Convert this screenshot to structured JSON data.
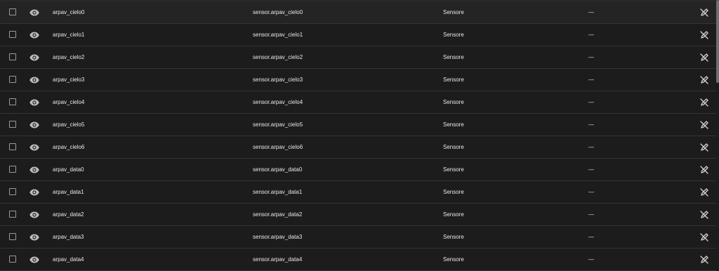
{
  "rows": [
    {
      "name": "arpav_cielo0",
      "entity_id": "sensor.arpav_cielo0",
      "integration": "Sensore",
      "area": "—"
    },
    {
      "name": "arpav_cielo1",
      "entity_id": "sensor.arpav_cielo1",
      "integration": "Sensore",
      "area": "—"
    },
    {
      "name": "arpav_cielo2",
      "entity_id": "sensor.arpav_cielo2",
      "integration": "Sensore",
      "area": "—"
    },
    {
      "name": "arpav_cielo3",
      "entity_id": "sensor.arpav_cielo3",
      "integration": "Sensore",
      "area": "—"
    },
    {
      "name": "arpav_cielo4",
      "entity_id": "sensor.arpav_cielo4",
      "integration": "Sensore",
      "area": "—"
    },
    {
      "name": "arpav_cielo5",
      "entity_id": "sensor.arpav_cielo5",
      "integration": "Sensore",
      "area": "—"
    },
    {
      "name": "arpav_cielo6",
      "entity_id": "sensor.arpav_cielo6",
      "integration": "Sensore",
      "area": "—"
    },
    {
      "name": "arpav_data0",
      "entity_id": "sensor.arpav_data0",
      "integration": "Sensore",
      "area": "—"
    },
    {
      "name": "arpav_data1",
      "entity_id": "sensor.arpav_data1",
      "integration": "Sensore",
      "area": "—"
    },
    {
      "name": "arpav_data2",
      "entity_id": "sensor.arpav_data2",
      "integration": "Sensore",
      "area": "—"
    },
    {
      "name": "arpav_data3",
      "entity_id": "sensor.arpav_data3",
      "integration": "Sensore",
      "area": "—"
    },
    {
      "name": "arpav_data4",
      "entity_id": "sensor.arpav_data4",
      "integration": "Sensore",
      "area": "—"
    }
  ],
  "icons": {
    "visibility": "eye-icon",
    "status": "pencil-off-icon"
  },
  "colors": {
    "background": "#1c1c1c",
    "row_highlight": "#242424",
    "divider": "#343434",
    "icon": "#bdbdbd"
  }
}
